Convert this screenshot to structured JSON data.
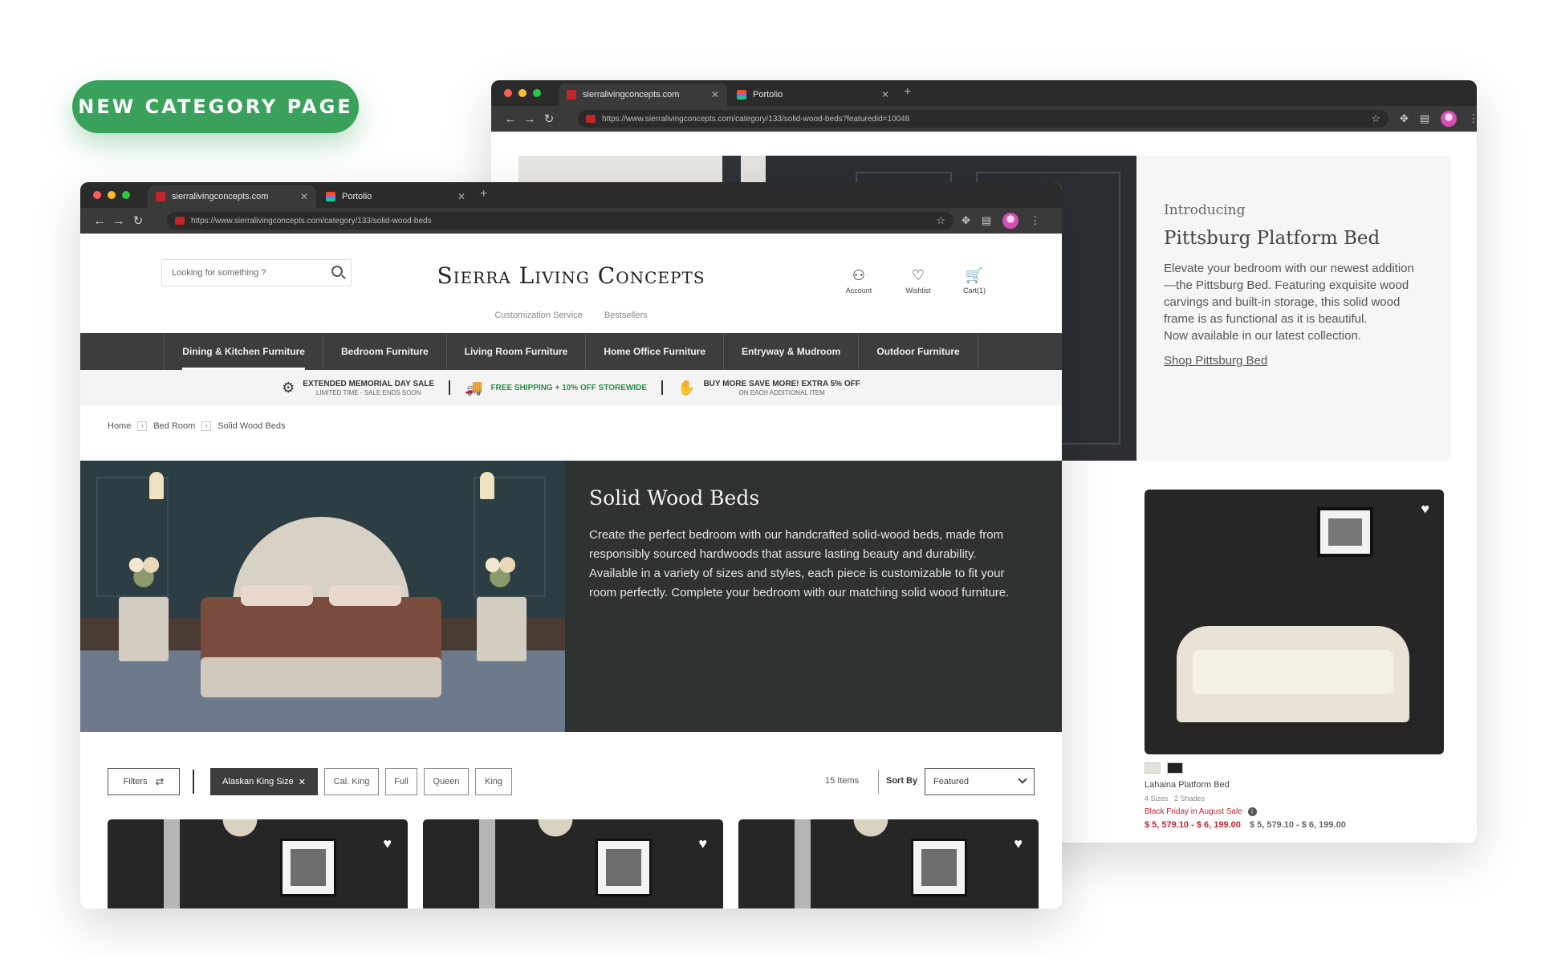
{
  "badge": "NEW CATEGORY PAGE",
  "back_browser": {
    "tabs": [
      {
        "title": "sierralivingconcepts.com"
      },
      {
        "title": "Portolio"
      }
    ],
    "url": "https://www.sierralivingconcepts.com/category/133/solid-wood-beds?featuredid=10048",
    "intro": {
      "kicker": "Introducing",
      "title": "Pittsburg Platform Bed",
      "body": "Elevate your bedroom with our newest addition—the Pittsburg Bed. Featuring exquisite wood carvings and built-in storage, this solid wood frame is as functional as it is beautiful.",
      "body2": "Now available in our latest collection.",
      "link": "Shop Pittsburg Bed"
    },
    "product": {
      "name": "Lahaina Platform Bed",
      "sizes": "4 Sizes",
      "shades": "2 Shades",
      "promo": "Black Friday in August Sale",
      "sale_price": "$ 5, 579.10 - $ 6, 199.00",
      "regular_price": "$ 5, 579.10 - $ 6, 199.00",
      "swatch_colors": [
        "#e4e2dc",
        "#222222"
      ]
    }
  },
  "front_browser": {
    "tabs": [
      {
        "title": "sierralivingconcepts.com"
      },
      {
        "title": "Portolio"
      }
    ],
    "url": "https://www.sierralivingconcepts.com/category/133/solid-wood-beds",
    "search_placeholder": "Looking for something ?",
    "logo": "Sierra Living Concepts",
    "sublinks": [
      "Customization Service",
      "Bestsellers"
    ],
    "header_icons": [
      {
        "label": "Account",
        "icon": "person-icon"
      },
      {
        "label": "Wishlist",
        "icon": "heart-icon"
      },
      {
        "label": "Cart(1)",
        "icon": "cart-icon"
      }
    ],
    "nav": [
      "Dining & Kitchen Furniture",
      "Bedroom Furniture",
      "Living Room Furniture",
      "Home Office Furniture",
      "Entryway & Mudroom",
      "Outdoor Furniture"
    ],
    "promos": [
      {
        "line1": "EXTENDED MEMORIAL DAY SALE",
        "line2": "LIMITED TIME - SALE ENDS SOON",
        "icon": "tag-icon"
      },
      {
        "line1": "FREE SHIPPING + 10% OFF STOREWIDE",
        "line2": "",
        "icon": "truck-icon"
      },
      {
        "line1": "BUY MORE SAVE MORE! EXTRA 5% OFF",
        "line2": "ON EACH ADDITIONAL ITEM",
        "icon": "hand-coin-icon"
      }
    ],
    "breadcrumb": [
      "Home",
      "Bed Room",
      "Solid Wood Beds"
    ],
    "hero": {
      "title": "Solid Wood Beds",
      "description": "Create the perfect bedroom with our handcrafted solid-wood beds, made from responsibly sourced hardwoods that assure lasting beauty and durability. Available in a variety of sizes and styles, each piece is customizable to fit your room perfectly. Complete your bedroom with our matching solid wood furniture."
    },
    "filters": {
      "filters_label": "Filters",
      "chips": [
        {
          "label": "Alaskan King Size",
          "active": true
        },
        {
          "label": "Cal. King",
          "active": false
        },
        {
          "label": "Full",
          "active": false
        },
        {
          "label": "Queen",
          "active": false
        },
        {
          "label": "King",
          "active": false
        }
      ],
      "count": "15 Items",
      "sort_label": "Sort By",
      "sort_value": "Featured"
    }
  }
}
